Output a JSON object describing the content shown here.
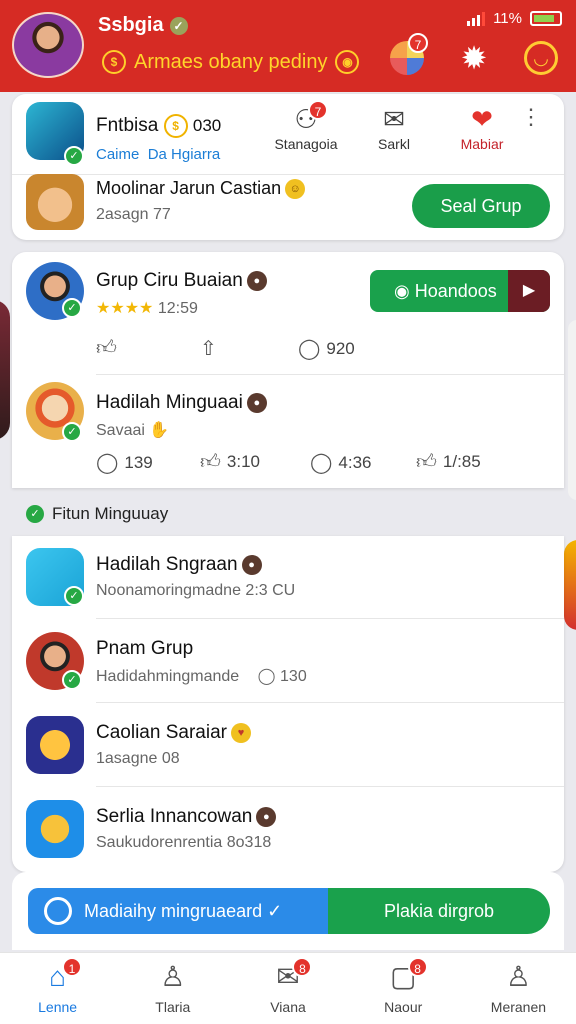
{
  "header": {
    "username": "Ssbgia",
    "subtitle": "Armaes obany pediny",
    "status_signal": "11%",
    "notif_count": "7"
  },
  "card1": {
    "user": "Fntbisa",
    "user_meta": "030",
    "user_sub1": "Caime",
    "user_sub2": "Da Hgiarra",
    "tabs": [
      {
        "icon": "chat-group-icon",
        "label": "Stanagoia",
        "badge": "7"
      },
      {
        "icon": "mail-icon",
        "label": "Sarkl"
      },
      {
        "icon": "heart-icon",
        "label": "Mabiar"
      }
    ],
    "row2_title": "Moolinar Jarun Castian",
    "row2_sub": "2asagn 77",
    "row2_button": "Seal Grup"
  },
  "card2": {
    "item1": {
      "title": "Grup Ciru Buaian",
      "rating": "★★★★",
      "rating_value": "12:59",
      "follow_label": "Hoandoos",
      "reactions": [
        "",
        "",
        "920"
      ]
    },
    "item2": {
      "title": "Hadilah Minguaai",
      "sub": "Savaai",
      "reactions": [
        "139",
        "3:10",
        "4:36",
        "1/:85"
      ]
    }
  },
  "section": {
    "label": "Fitun Minguuay",
    "items": [
      {
        "title": "Hadilah Sngraan",
        "sub": "Noonamoringmadne 2:3 CU"
      },
      {
        "title": "Pnam Grup",
        "sub": "Hadidahmingmande",
        "count": "130"
      },
      {
        "title": "Caolian Saraiar",
        "sub": "1asagne 08"
      },
      {
        "title": "Serlia Innancowan",
        "sub": "Saukudorenrentia 8o318"
      }
    ]
  },
  "bottom_buttons": {
    "left": "Madiaihy mingruaeard",
    "right": "Plakia dirgrob"
  },
  "nav": [
    {
      "label": "Lenne",
      "icon": "home-icon",
      "badge": "1"
    },
    {
      "label": "Tlaria",
      "icon": "person-icon"
    },
    {
      "label": "Viana",
      "icon": "inbox-icon",
      "badge": "8"
    },
    {
      "label": "Naour",
      "icon": "bookmark-icon",
      "badge": "8"
    },
    {
      "label": "Meranen",
      "icon": "profile-icon"
    }
  ]
}
